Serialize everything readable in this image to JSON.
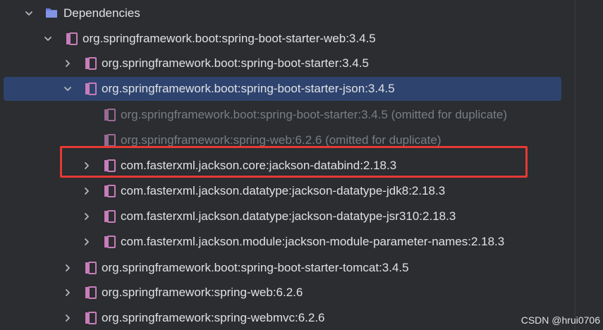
{
  "tree": {
    "root": {
      "label": "Dependencies",
      "icon": "folder-icon",
      "expanded": true
    },
    "items": [
      {
        "label": "org.springframework.boot:spring-boot-starter-web:3.4.5",
        "level": 1,
        "expanded": true
      },
      {
        "label": "org.springframework.boot:spring-boot-starter:3.4.5",
        "level": 2,
        "expanded": false
      },
      {
        "label": "org.springframework.boot:spring-boot-starter-json:3.4.5",
        "level": 2,
        "expanded": true,
        "selected": true
      },
      {
        "label": "org.springframework.boot:spring-boot-starter:3.4.5 (omitted for duplicate)",
        "level": 3,
        "dim": true
      },
      {
        "label": "org.springframework:spring-web:6.2.6 (omitted for duplicate)",
        "level": 3,
        "dim": true
      },
      {
        "label": "com.fasterxml.jackson.core:jackson-databind:2.18.3",
        "level": 3,
        "expanded": false,
        "highlighted": true
      },
      {
        "label": "com.fasterxml.jackson.datatype:jackson-datatype-jdk8:2.18.3",
        "level": 3,
        "expanded": false
      },
      {
        "label": "com.fasterxml.jackson.datatype:jackson-datatype-jsr310:2.18.3",
        "level": 3,
        "expanded": false
      },
      {
        "label": "com.fasterxml.jackson.module:jackson-module-parameter-names:2.18.3",
        "level": 3,
        "expanded": false
      },
      {
        "label": "org.springframework.boot:spring-boot-starter-tomcat:3.4.5",
        "level": 2,
        "expanded": false
      },
      {
        "label": "org.springframework:spring-web:6.2.6",
        "level": 2,
        "expanded": false
      },
      {
        "label": "org.springframework:spring-webmvc:6.2.6",
        "level": 2,
        "expanded": false
      }
    ]
  },
  "colors": {
    "background": "#2b2d30",
    "selection": "#2e436e",
    "library_icon": "#c77dbb",
    "folder_icon": "#6b7fd7",
    "highlight_border": "#e53935"
  },
  "watermark": "CSDN @hrui0706"
}
